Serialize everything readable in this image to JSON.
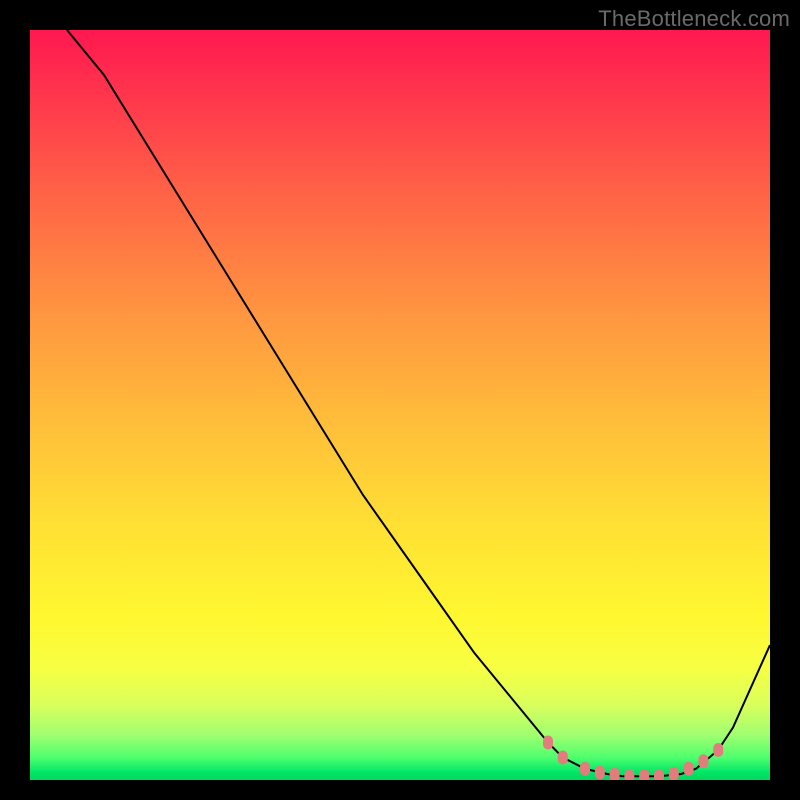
{
  "watermark": "TheBottleneck.com",
  "chart_data": {
    "type": "line",
    "title": "",
    "xlabel": "",
    "ylabel": "",
    "xlim": [
      0,
      100
    ],
    "ylim": [
      0,
      100
    ],
    "series": [
      {
        "name": "bottleneck-curve",
        "x": [
          5,
          10,
          15,
          20,
          25,
          30,
          35,
          40,
          45,
          50,
          55,
          60,
          65,
          70,
          72,
          75,
          78,
          80,
          82,
          85,
          88,
          90,
          93,
          95,
          100
        ],
        "y": [
          100,
          94,
          86,
          78,
          70,
          62,
          54,
          46,
          38,
          31,
          24,
          17,
          11,
          5,
          3,
          1.5,
          0.8,
          0.5,
          0.5,
          0.5,
          0.8,
          1.5,
          4,
          7,
          18
        ]
      }
    ],
    "markers": {
      "name": "highlight-points",
      "color": "#e37c7c",
      "x": [
        70,
        72,
        75,
        77,
        79,
        81,
        83,
        85,
        87,
        89,
        91,
        93
      ],
      "y": [
        5,
        3,
        1.5,
        1.0,
        0.7,
        0.5,
        0.5,
        0.5,
        0.8,
        1.5,
        2.5,
        4
      ]
    }
  }
}
